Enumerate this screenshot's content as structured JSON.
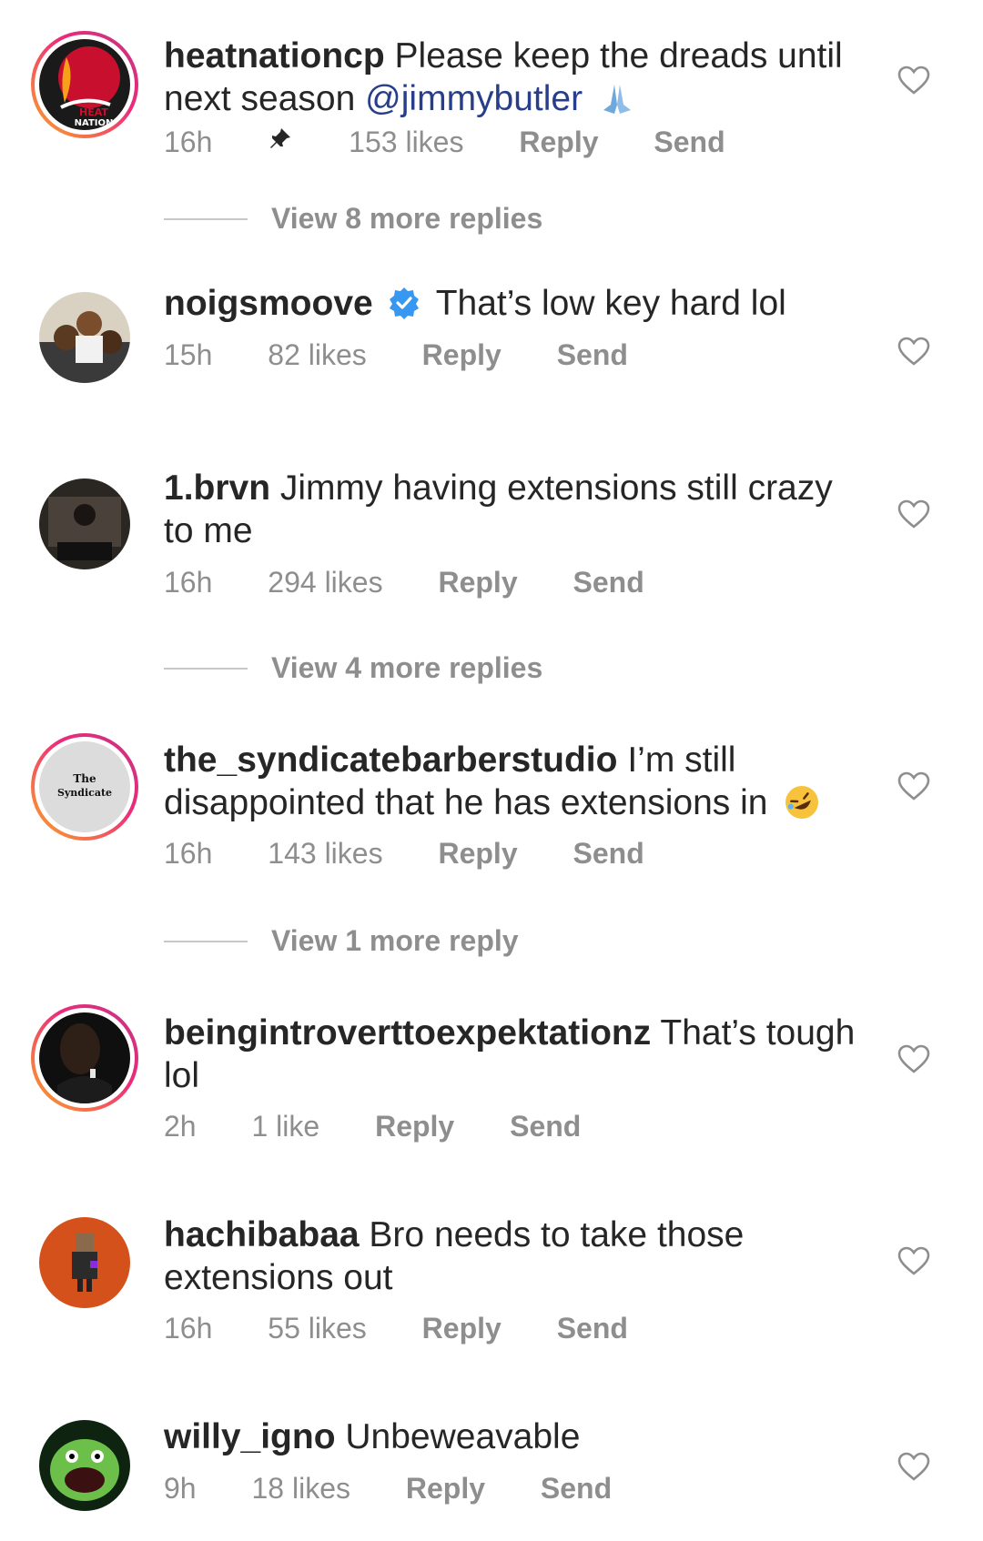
{
  "comments": [
    {
      "username": "heatnationcp",
      "text_before": "Please keep the dreads until next season",
      "mention": "@jimmybutler",
      "emoji": "folded-hands",
      "time": "16h",
      "pinned": true,
      "likes": "153 likes",
      "reply": "Reply",
      "send": "Send",
      "avatar_text_1": "HEAT",
      "avatar_text_2": "NATION"
    },
    {
      "username": "noigsmoove",
      "verified": true,
      "text": "That’s low key hard lol",
      "time": "15h",
      "likes": "82 likes",
      "reply": "Reply",
      "send": "Send"
    },
    {
      "username": "1.brvn",
      "text": "Jimmy having extensions still crazy to me",
      "time": "16h",
      "likes": "294 likes",
      "reply": "Reply",
      "send": "Send"
    },
    {
      "username": "the_syndicatebarberstudio",
      "text": "I’m still disappointed that he has extensions in",
      "emoji": "rofl",
      "time": "16h",
      "likes": "143 likes",
      "reply": "Reply",
      "send": "Send",
      "avatar_text_1": "The",
      "avatar_text_2": "Syndicate"
    },
    {
      "username": "beingintroverttoexpektationz",
      "text": "That’s tough lol",
      "time": "2h",
      "likes": "1 like",
      "reply": "Reply",
      "send": "Send"
    },
    {
      "username": "hachibabaa",
      "text": "Bro needs to take those extensions out",
      "time": "16h",
      "likes": "55 likes",
      "reply": "Reply",
      "send": "Send"
    },
    {
      "username": "willy_igno",
      "text": "Unbeweavable",
      "time": "9h",
      "likes": "18 likes",
      "reply": "Reply",
      "send": "Send"
    }
  ],
  "view_more": [
    "View 8 more replies",
    "View 4 more replies",
    "View 1 more reply"
  ],
  "colors": {
    "mention": "#283e8a",
    "meta": "#8e8e8e",
    "verified": "#3897f0"
  }
}
